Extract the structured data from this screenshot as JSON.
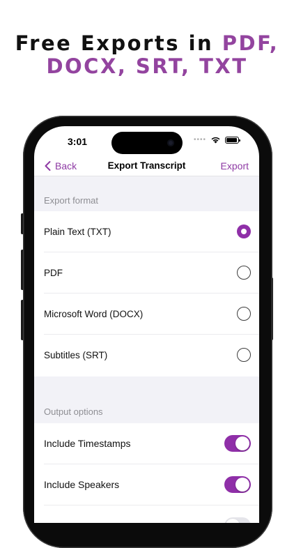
{
  "headline": {
    "line1_prefix": "Free Exports in ",
    "line1_accent": "PDF,",
    "line2_accent": "DOCX, SRT, TXT"
  },
  "status_bar": {
    "time": "3:01",
    "signal": "••••"
  },
  "nav": {
    "back_label": "Back",
    "title": "Export Transcript",
    "action_label": "Export"
  },
  "export_format": {
    "header": "Export format",
    "options": [
      {
        "label": "Plain Text (TXT)",
        "selected": true
      },
      {
        "label": "PDF",
        "selected": false
      },
      {
        "label": "Microsoft Word (DOCX)",
        "selected": false
      },
      {
        "label": "Subtitles (SRT)",
        "selected": false
      }
    ]
  },
  "output_options": {
    "header": "Output options",
    "items": [
      {
        "label": "Include Timestamps",
        "on": true
      },
      {
        "label": "Include Speakers",
        "on": true
      },
      {
        "label": "",
        "on": false
      }
    ]
  },
  "colors": {
    "accent": "#8f2fa8",
    "headline_accent": "#93449f",
    "grouped_background": "#f2f2f7"
  },
  "icons": [
    "chevron-left-icon",
    "wifi-icon",
    "battery-icon",
    "camera-icon"
  ]
}
